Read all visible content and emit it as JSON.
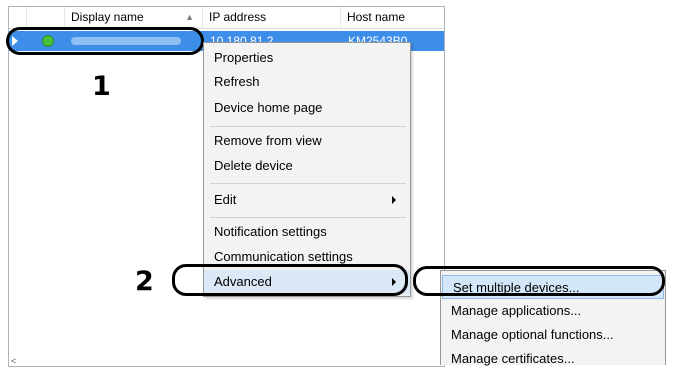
{
  "list": {
    "columns": {
      "display_name": "Display name",
      "ip_address": "IP address",
      "host_name": "Host name"
    },
    "sort_indicator": "▲",
    "row": {
      "ip": "10.180.81.2",
      "host": "KM2543B0",
      "status_color": "#45c23a",
      "selected_color": "#3d8ee8"
    },
    "scroll_arrow": "<"
  },
  "callouts": {
    "one": "1",
    "two": "2"
  },
  "context_menu": {
    "properties": "Properties",
    "refresh": "Refresh",
    "home_page": "Device home page",
    "remove": "Remove from view",
    "delete": "Delete device",
    "edit": "Edit",
    "notification": "Notification settings",
    "communication": "Communication settings",
    "advanced": "Advanced"
  },
  "submenu": {
    "set_multiple": "Set multiple devices...",
    "manage_apps": "Manage applications...",
    "manage_optional": "Manage optional functions...",
    "manage_certs": "Manage certificates..."
  },
  "icons": {
    "expand": "expand-triangle-icon",
    "status": "status-online-icon",
    "submenu": "submenu-arrow-icon"
  }
}
